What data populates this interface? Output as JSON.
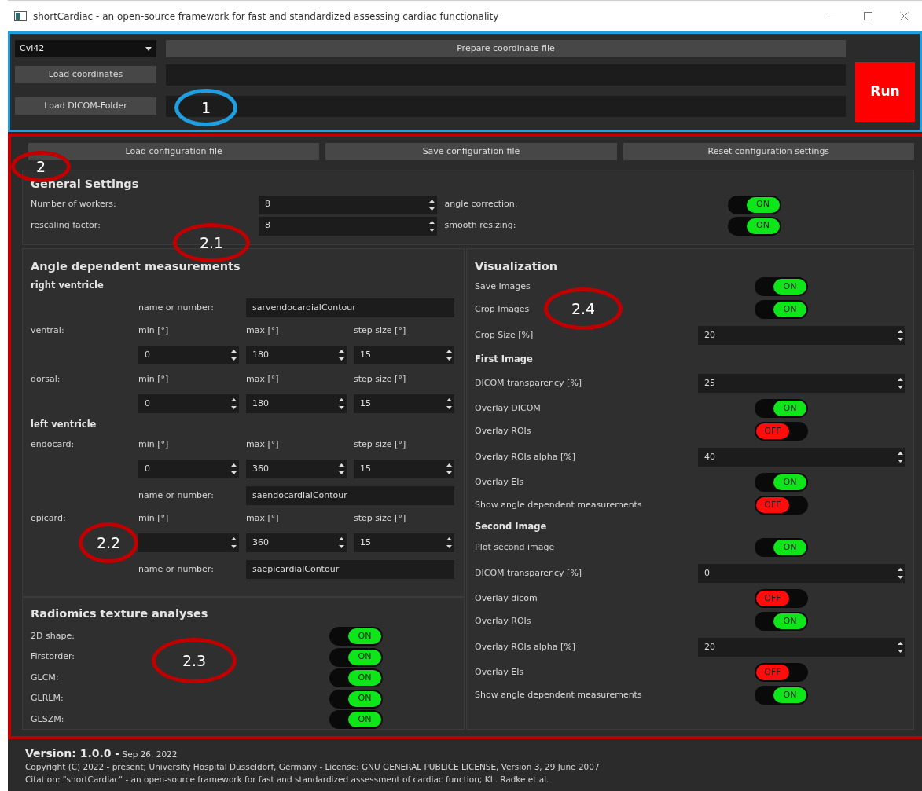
{
  "window": {
    "title": "shortCardiac - an open-source framework for fast and standardized assessing cardiac functionality"
  },
  "input_panel": {
    "format_dropdown": "Cvi42",
    "prepare_button": "Prepare coordinate file",
    "load_coordinates_button": "Load coordinates",
    "load_dicom_button": "Load DICOM-Folder",
    "run_button": "Run"
  },
  "config_buttons": [
    "Load configuration file",
    "Save configuration file",
    "Reset configuration settings"
  ],
  "general_settings": {
    "title": "General Settings",
    "spinboxes": [
      {
        "label": "Number of workers:",
        "value": "8"
      },
      {
        "label": "rescaling factor:",
        "value": "8"
      }
    ],
    "toggles": [
      {
        "label": "angle correction:",
        "on": true,
        "text": "ON"
      },
      {
        "label": "smooth resizing:",
        "on": true,
        "text": "ON"
      }
    ]
  },
  "angle_measurements": {
    "title": "Angle dependent measurements",
    "groups": [
      {
        "title": "right ventricle",
        "rows": [
          {
            "kind": "name",
            "label": "name or number:",
            "value": "sarvendocardialContour"
          },
          {
            "kind": "range",
            "label": "ventral:",
            "min_label": "min [°]",
            "max_label": "max [°]",
            "step_label": "step size [°]",
            "min": "0",
            "max": "180",
            "step": "15"
          },
          {
            "kind": "range",
            "label": "dorsal:",
            "min_label": "min [°]",
            "max_label": "max [°]",
            "step_label": "step size [°]",
            "min": "0",
            "max": "180",
            "step": "15"
          }
        ]
      },
      {
        "title": "left ventricle",
        "rows": [
          {
            "kind": "range",
            "label": "endocard:",
            "min_label": "min [°]",
            "max_label": "max [°]",
            "step_label": "step size [°]",
            "min": "0",
            "max": "360",
            "step": "15"
          },
          {
            "kind": "name",
            "label": "name or number:",
            "value": "saendocardialContour"
          },
          {
            "kind": "range",
            "label": "epicard:",
            "min_label": "min [°]",
            "max_label": "max [°]",
            "step_label": "step size [°]",
            "max": "360",
            "step": "15"
          },
          {
            "kind": "name",
            "label": "name or number:",
            "value": "saepicardialContour"
          }
        ]
      }
    ]
  },
  "radiomics": {
    "title": "Radiomics texture analyses",
    "toggles": [
      {
        "label": "2D shape:",
        "on": true,
        "text": "ON"
      },
      {
        "label": "Firstorder:",
        "on": true,
        "text": "ON"
      },
      {
        "label": "GLCM:",
        "on": true,
        "text": "ON"
      },
      {
        "label": "GLRLM:",
        "on": true,
        "text": "ON"
      },
      {
        "label": "GLSZM:",
        "on": true,
        "text": "ON"
      }
    ]
  },
  "visualization": {
    "title": "Visualization",
    "rows": [
      {
        "kind": "toggle",
        "label": "Save Images",
        "on": true,
        "text": "ON"
      },
      {
        "kind": "toggle",
        "label": "Crop Images",
        "on": true,
        "text": "ON"
      },
      {
        "kind": "spin",
        "label": "Crop Size [%]",
        "value": "20"
      },
      {
        "kind": "heading",
        "label": "First Image"
      },
      {
        "kind": "spin",
        "label": "DICOM transparency [%]",
        "value": "25"
      },
      {
        "kind": "toggle",
        "label": "Overlay DICOM",
        "on": true,
        "text": "ON"
      },
      {
        "kind": "toggle",
        "label": "Overlay ROIs",
        "on": false,
        "text": "OFF"
      },
      {
        "kind": "spin",
        "label": "Overlay ROIs alpha [%]",
        "value": "40"
      },
      {
        "kind": "toggle",
        "label": "Overlay EIs",
        "on": true,
        "text": "ON"
      },
      {
        "kind": "toggle",
        "label": "Show angle dependent measurements",
        "on": false,
        "text": "OFF"
      },
      {
        "kind": "heading",
        "label": "Second Image"
      },
      {
        "kind": "toggle",
        "label": "Plot second image",
        "on": true,
        "text": "ON"
      },
      {
        "kind": "spin",
        "label": "DICOM transparency [%]",
        "value": "0"
      },
      {
        "kind": "toggle",
        "label": "Overlay dicom",
        "on": false,
        "text": "OFF"
      },
      {
        "kind": "toggle",
        "label": "Overlay ROIs",
        "on": true,
        "text": "ON"
      },
      {
        "kind": "spin",
        "label": "Overlay ROIs alpha [%]",
        "value": "20"
      },
      {
        "kind": "toggle",
        "label": "Overlay EIs",
        "on": false,
        "text": "OFF"
      },
      {
        "kind": "toggle",
        "label": "Show angle dependent measurements",
        "on": true,
        "text": "ON"
      }
    ]
  },
  "footer": {
    "version": "**Version: 1.0.0 -** Sep 26, 2022",
    "copyright": "Copyright (C) 2022 - present; University Hospital Düsseldorf, Germany - License: GNU GENERAL PUBLICE LICENSE, Version 3, 29 June 2007",
    "citation": "Citation: \"shortCardiac\" - an open-source framework for fast and standardized assessment of cardiac function; KL. Radke et al."
  },
  "annotations": [
    {
      "label": "1",
      "color": "#1f9fe0"
    },
    {
      "label": "2",
      "color": "#c00000"
    },
    {
      "label": "2.1",
      "color": "#c00000"
    },
    {
      "label": "2.2",
      "color": "#c00000"
    },
    {
      "label": "2.3",
      "color": "#c00000"
    },
    {
      "label": "2.4",
      "color": "#c00000"
    }
  ]
}
